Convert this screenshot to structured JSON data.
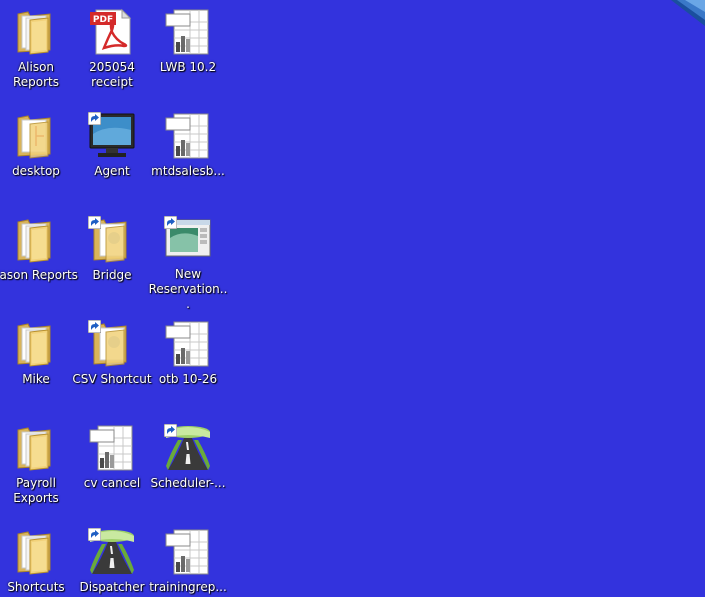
{
  "desktop": {
    "background_color": "#3333dd",
    "icons": [
      {
        "label": "Alison\nReports",
        "type": "folder"
      },
      {
        "label": "205054\nreceipt",
        "type": "pdf"
      },
      {
        "label": "LWB 10.2",
        "type": "report"
      },
      {
        "label": "desktop",
        "type": "folder-red"
      },
      {
        "label": "Agent",
        "type": "monitor"
      },
      {
        "label": "mtdsalesb...",
        "type": "report"
      },
      {
        "label": "Jason Reports",
        "type": "folder"
      },
      {
        "label": "Bridge",
        "type": "folder-shortcut"
      },
      {
        "label": "New\nReservation...",
        "type": "window-app"
      },
      {
        "label": "Mike",
        "type": "folder"
      },
      {
        "label": "CSV Shortcut",
        "type": "folder-shortcut"
      },
      {
        "label": "otb 10-26",
        "type": "report"
      },
      {
        "label": "Payroll\nExports",
        "type": "folder"
      },
      {
        "label": "cv cancel",
        "type": "report"
      },
      {
        "label": "Scheduler-...",
        "type": "road-app"
      },
      {
        "label": "Shortcuts",
        "type": "folder"
      },
      {
        "label": "Dispatcher",
        "type": "road-app"
      },
      {
        "label": "trainingrep...",
        "type": "report"
      }
    ],
    "pdf_badge": "PDF"
  }
}
